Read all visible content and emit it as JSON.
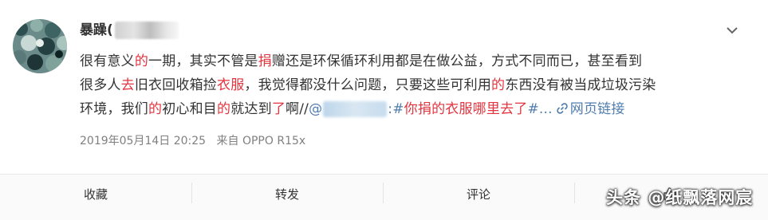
{
  "post": {
    "username": "暴躁(",
    "more_icon": "chevron-down-icon",
    "content": {
      "l1_a": "很有意义",
      "l1_b": "的",
      "l1_c": "一期，其实不管是",
      "l1_d": "捐",
      "l1_e": "赠还是环保循环利用都是在做公益，方式不同而已，甚至看到",
      "l2_a": "很多人",
      "l2_b": "去",
      "l2_c": "旧衣回收箱捡",
      "l2_d": "衣服",
      "l2_e": "，我觉得都没什么问题，只要这些可利用",
      "l2_f": "的",
      "l2_g": "东西没有被当成垃圾污染",
      "l3_a": "环境，我们",
      "l3_b": "的",
      "l3_c": "初心和目",
      "l3_d": "的",
      "l3_e": "就达到",
      "l3_f": "了",
      "l3_g": "啊//",
      "l3_mention": "@",
      "l3_colon": ":#",
      "l3_topic": "你捐的衣服哪里去了",
      "l3_end": "#...",
      "l3_link_icon": "link-icon",
      "l3_link": "网页链接"
    },
    "meta": {
      "date": "2019年05月14日 20:25",
      "source": "来自 OPPO R15x"
    }
  },
  "actions": {
    "favorite": "收藏",
    "repost": "转发",
    "comment": "评论",
    "like_icon": "thumbs-up-icon"
  },
  "watermark": "头条 @纸飘落网宸",
  "colors": {
    "highlight": "#e3343f",
    "link": "#507daf",
    "meta": "#808080"
  }
}
